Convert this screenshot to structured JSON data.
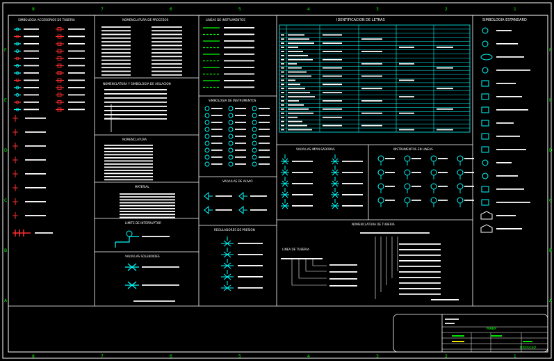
{
  "colors": {
    "background": "#000000",
    "border": "#ffffff",
    "symbol": "#00ffff",
    "green": "#00ff00",
    "yellow": "#ffff00",
    "red": "#ff3030",
    "text": "#ffffff"
  },
  "grid_labels": {
    "columns": [
      "8",
      "7",
      "6",
      "5",
      "4",
      "3",
      "2",
      "1"
    ],
    "rows": [
      "F",
      "E",
      "D",
      "C",
      "B",
      "A"
    ]
  },
  "sections": {
    "piping": "SIMBOLOGIA ACCESORIOS DE TUBERIA",
    "process_nomen": "NOMENCLATURA DE PROCESOS",
    "instr_lines": "LINEAS DE INSTRUMENTOS",
    "letter_id": "IDENTIFICACION DE LETRAS",
    "standard": "SIMBOLOGIA ESTANDARD",
    "insulation": "NOMENCLATURA Y SIMBOLOGIA DE AISLACION",
    "instr_symbols": "SIMBOLOGIA DE INSTRUMENTOS",
    "nomenclature": "NOMENCLATURA",
    "material": "MATERIAL",
    "interrupter_limit": "LIMITE DE INTERRUPTOR",
    "solenoid_valves": "VALVULAS SOLENOIDES",
    "relief_valves": "VALVULAS DE ALIVIO",
    "pressure_reg": "REGULADORES DE PRESION",
    "pneumatic_valves": "VALVULAS IMPULSADORAS",
    "inline_instruments": "INSTRUMENTOS EN LINEAS",
    "pipe_nomen": "NOMENCLATURA DE TUBERIA",
    "pipe_line": "LINEA DE TUBERIA"
  },
  "title_block": {
    "stamp": "MARP",
    "logo": "Bibliocad"
  }
}
